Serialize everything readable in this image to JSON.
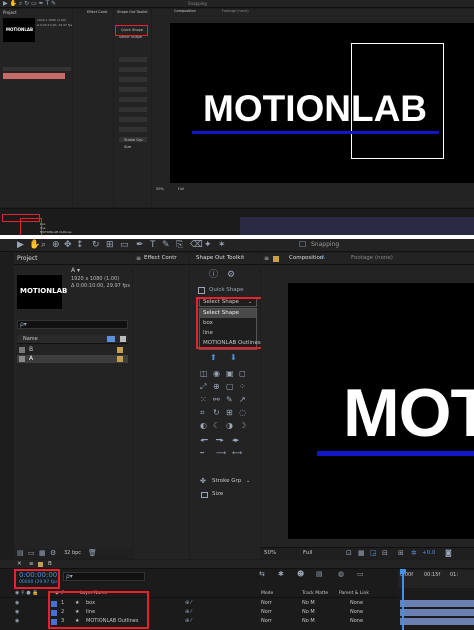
{
  "menu": {
    "snapping": "Snapping"
  },
  "project": {
    "tab": "Project",
    "thumb_text": "MOTIONLAB",
    "comp_name": "A ▾",
    "comp_dims": "1920 x 1080 (1.00)",
    "comp_dur": "Δ 0:00:10:00, 29.97 fps",
    "search": "ρ▾",
    "col_name": "Name",
    "items": [
      {
        "name": "B"
      },
      {
        "name": "A"
      }
    ],
    "bpc": "32 bpc"
  },
  "effect_controls": {
    "tab": "Effect Contr"
  },
  "toolkit": {
    "tab": "Shape Out Toolkit",
    "quick_shape": "Quick Shape",
    "select_label": "Select Shape",
    "options": [
      "Select Shape",
      "box",
      "line",
      "MOTIONLAB Outlines"
    ],
    "stroke_label": "Stroke Grp",
    "size_label": "Size"
  },
  "viewer": {
    "tab_comp": "Composition",
    "tab_comp_name": "A",
    "tab_footage": "Footage (none)",
    "title": "MOTIONLAB",
    "title_partial": "MOT",
    "zoom": "50%",
    "quality": "Full",
    "exposure": "+0.0",
    "colors": {
      "accent_line": "#1414c8",
      "canvas": "#000000"
    }
  },
  "timeline": {
    "tab": "B",
    "timecode": "0:00:00:00",
    "frame": "00000 (29.97 fps)",
    "search": "ρ▾",
    "ruler": [
      "0:00f",
      "00:15f",
      "01:"
    ],
    "columns": {
      "layer_name": "Layer Name",
      "mode": "Mode",
      "track_matte": "Track Matte",
      "parent": "Parent & Link"
    },
    "layers": [
      {
        "num": "1",
        "name": "box",
        "mode": "Norr",
        "matte": "No M",
        "parent": "None"
      },
      {
        "num": "2",
        "name": "line",
        "mode": "Norr",
        "matte": "No M",
        "parent": "None"
      },
      {
        "num": "3",
        "name": "MOTIONLAB Outlines",
        "mode": "Norr",
        "matte": "No M",
        "parent": "None"
      }
    ]
  },
  "top": {
    "layer_names": [
      "box",
      "line",
      "MOTIONLAB Outlines"
    ]
  }
}
